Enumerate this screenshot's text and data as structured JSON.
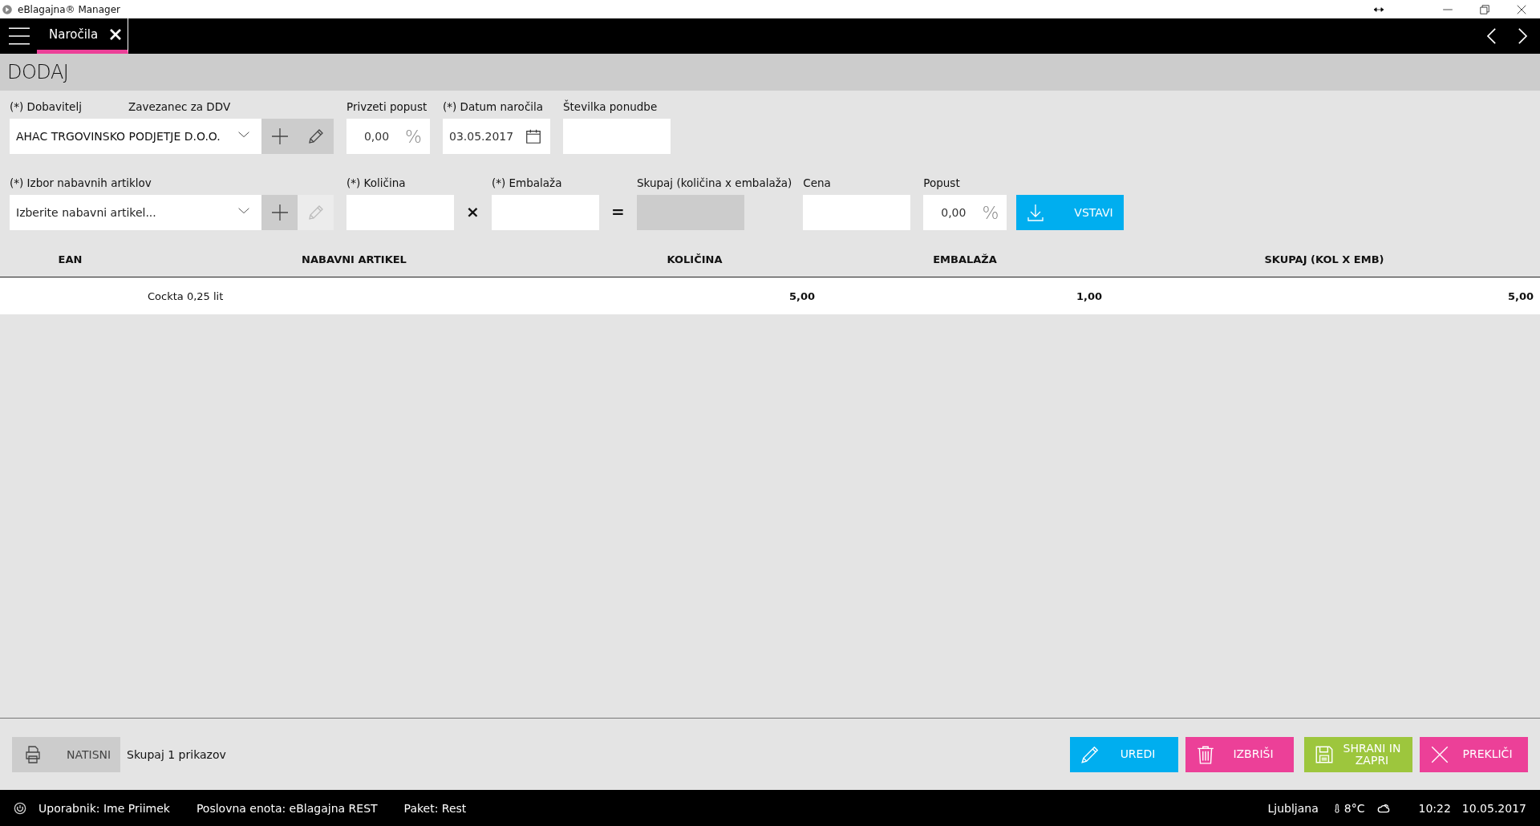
{
  "window": {
    "title": "eBlagajna® Manager"
  },
  "tabs": [
    {
      "label": "Naročila",
      "selected": true
    }
  ],
  "page_title": "DODAJ",
  "form": {
    "supplier": {
      "label": "(*) Dobavitelj",
      "secondary_label": "Zavezanec za DDV",
      "value": "AHAC TRGOVINSKO PODJETJE D.O.O.",
      "edit_disabled": false
    },
    "default_discount": {
      "label": "Privzeti popust",
      "value": "0,00",
      "unit": "%"
    },
    "order_date": {
      "label": "(*) Datum naročila",
      "value": "03.05.2017"
    },
    "offer_number": {
      "label": "Številka ponudbe"
    },
    "article": {
      "label": "(*) Izbor nabavnih artiklov",
      "placeholder": "Izberite nabavni artikel...",
      "edit_disabled": true
    },
    "quantity": {
      "label": "(*) Količina"
    },
    "multiply_sign": "×",
    "packaging": {
      "label": "(*) Embalaža"
    },
    "equals_sign": "=",
    "total": {
      "label": "Skupaj (količina x embalaža)"
    },
    "price": {
      "label": "Cena"
    },
    "discount": {
      "label": "Popust",
      "value": "0,00",
      "unit": "%"
    },
    "insert_button": "VSTAVI"
  },
  "table": {
    "columns": [
      "EAN",
      "NABAVNI ARTIKEL",
      "KOLIČINA",
      "EMBALAŽA",
      "SKUPAJ (KOL X EMB)"
    ],
    "rows": [
      {
        "ean": "",
        "article": "Cockta 0,25 lit",
        "quantity": "5,00",
        "packaging": "1,00",
        "total": "5,00"
      }
    ]
  },
  "footer": {
    "print_button": "NATISNI",
    "count": "Skupaj 1 prikazov",
    "buttons": [
      {
        "kind": "edit",
        "label": "UREDI"
      },
      {
        "kind": "delete",
        "label": "IZBRIŠI"
      },
      {
        "kind": "save",
        "label": "SHRANI IN ZAPRI"
      },
      {
        "kind": "cancel",
        "label": "PREKLIČI"
      }
    ]
  },
  "status_bar": {
    "user": "Uporabnik: Ime Priimek",
    "unit": "Poslovna enota: eBlagajna REST",
    "package": "Paket: Rest",
    "city": "Ljubljana",
    "temperature": "8°C",
    "time": "10:22",
    "date": "10.05.2017"
  }
}
